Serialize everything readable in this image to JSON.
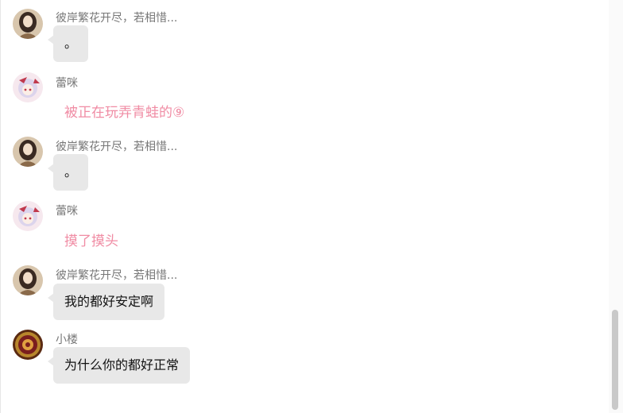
{
  "messages": [
    {
      "name": "彼岸繁花开尽，若相惜...",
      "text": "。",
      "avatar": "girl-brown-hair-avatar"
    },
    {
      "name": "蕾咪",
      "text": "被正在玩弄青蛙的⑨",
      "avatar": "anime-remilia-avatar"
    },
    {
      "name": "彼岸繁花开尽，若相惜...",
      "text": "。",
      "avatar": "girl-brown-hair-avatar"
    },
    {
      "name": "蕾咪",
      "text": "摸了摸头",
      "avatar": "anime-remilia-avatar"
    },
    {
      "name": "彼岸繁花开尽，若相惜...",
      "text": "我的都好安定啊",
      "avatar": "girl-brown-hair-avatar"
    },
    {
      "name": "小楼",
      "text": "为什么你的都好正常",
      "avatar": "gold-badge-avatar"
    }
  ],
  "colors": {
    "bubble_bg": "#e8e8e8",
    "pink_text": "#f08ca4",
    "name_text": "#777777"
  }
}
